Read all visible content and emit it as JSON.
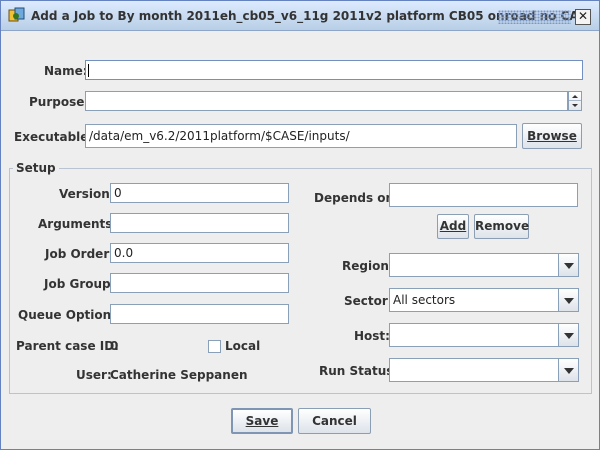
{
  "window": {
    "title": "Add a Job to By month 2011eh_cb05_v6_11g 2011v2 platform CB05 onroad no CA",
    "close_icon": "close-icon",
    "app_icon": "app-icon"
  },
  "form": {
    "name_label": "Name:",
    "name_value": "",
    "purpose_label": "Purpose:",
    "purpose_value": "",
    "executable_label": "Executable:",
    "executable_value": "/data/em_v6.2/2011platform/$CASE/inputs/",
    "browse_label": "Browse"
  },
  "setup": {
    "title": "Setup",
    "version_label": "Version:",
    "version_value": "0",
    "arguments_label": "Arguments:",
    "arguments_value": "",
    "job_order_label": "Job Order:",
    "job_order_value": "0.0",
    "job_group_label": "Job Group:",
    "job_group_value": "",
    "queue_options_label": "Queue Options:",
    "queue_options_value": "",
    "parent_case_label": "Parent case ID:",
    "parent_case_value": "0",
    "local_label": "Local",
    "local_checked": false,
    "user_label": "User:",
    "user_value": "Catherine Seppanen",
    "depends_on_label": "Depends on:",
    "depends_on_value": "",
    "add_label": "Add",
    "remove_label": "Remove",
    "region_label": "Region:",
    "region_value": "",
    "sector_label": "Sector:",
    "sector_value": "All sectors",
    "host_label": "Host:",
    "host_value": "",
    "run_status_label": "Run Status:",
    "run_status_value": ""
  },
  "footer": {
    "save_label": "Save",
    "cancel_label": "Cancel"
  }
}
